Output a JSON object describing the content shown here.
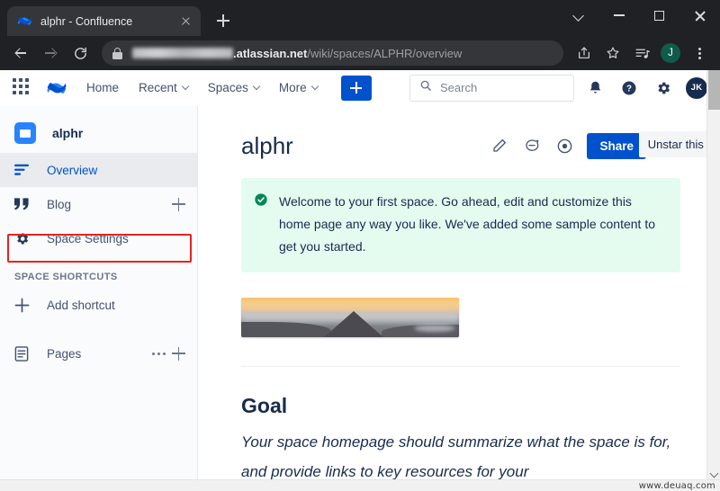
{
  "browser": {
    "tab": {
      "title": "alphr - Confluence",
      "favicon": "confluence-favicon",
      "close": "close-tab-icon"
    },
    "new_tab_label": "+",
    "window_controls": {
      "chevron": "chevron-down-icon",
      "minimize": "minimize-icon",
      "maximize": "maximize-icon",
      "close": "close-icon"
    },
    "url": {
      "redacted_prefix": "",
      "domain": ".atlassian.net",
      "path": "/wiki/spaces/ALPHR/overview",
      "lock": "lock-icon"
    },
    "toolbar_icons": [
      "share-icon",
      "bookmark-star-icon",
      "reading-list-icon",
      "kebab-menu-icon"
    ],
    "profile_initial": "J"
  },
  "topnav": {
    "app_switcher": "app-switcher-icon",
    "logo": "confluence-logo-icon",
    "items": [
      {
        "label": "Home",
        "has_chevron": false
      },
      {
        "label": "Recent",
        "has_chevron": true
      },
      {
        "label": "Spaces",
        "has_chevron": true
      },
      {
        "label": "More",
        "has_chevron": true
      }
    ],
    "create_button_label": "+",
    "search": {
      "placeholder": "Search",
      "icon": "search-icon"
    },
    "icons": [
      "notifications-bell-icon",
      "help-icon",
      "settings-gear-icon"
    ],
    "avatar_initials": "JK"
  },
  "sidebar": {
    "space_name": "alphr",
    "items": [
      {
        "label": "Overview",
        "icon": "overview-icon",
        "active": true,
        "action": null
      },
      {
        "label": "Blog",
        "icon": "blog-quote-icon",
        "active": false,
        "action": "plus"
      },
      {
        "label": "Space Settings",
        "icon": "gear-icon",
        "active": false,
        "action": null
      }
    ],
    "shortcuts_header": "SPACE SHORTCUTS",
    "add_shortcut_label": "Add shortcut",
    "pages_label": "Pages",
    "highlight_color": "#e8231f"
  },
  "main": {
    "page_title": "alphr",
    "actions": {
      "edit": "edit-pencil-icon",
      "comment": "comment-icon",
      "watch": "watch-eye-icon",
      "share_label": "Share",
      "more": "more-options-icon"
    },
    "tooltip_text": "Unstar this s",
    "banner": {
      "icon": "success-check-icon",
      "text": "Welcome to your first space. Go ahead, edit and customize this home page any way you like. We've added some sample content to get you started."
    },
    "image_alt": "sunset-mountain-photo",
    "goal_heading": "Goal",
    "goal_text": "Your space homepage should summarize what the space is for, and provide links to key resources for your"
  },
  "watermark": "www.deuaq.com",
  "colors": {
    "accent_blue": "#0052cc",
    "banner_green": "#e3fcef",
    "highlight_red": "#e8231f",
    "chrome_dark": "#202124"
  }
}
